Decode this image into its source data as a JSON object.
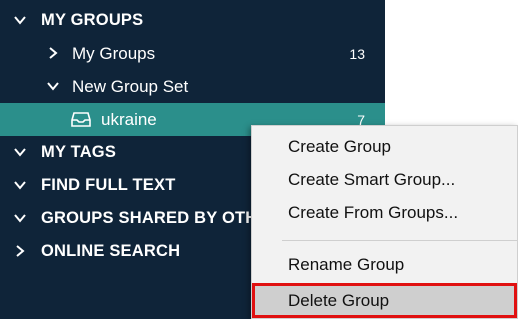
{
  "sidebar": {
    "my_groups_header": "MY GROUPS",
    "my_groups_item": "My Groups",
    "my_groups_count": "13",
    "group_set": "New Group Set",
    "ukraine_label": "ukraine",
    "ukraine_count": "7",
    "my_tags": "MY TAGS",
    "find_full_text": "FIND FULL TEXT",
    "groups_shared": "GROUPS SHARED BY OTHERS",
    "online_search": "ONLINE SEARCH"
  },
  "context_menu": {
    "items": [
      "Create Group",
      "Create Smart Group...",
      "Create From Groups...",
      "Rename Group",
      "Delete Group"
    ]
  },
  "colors": {
    "sidebar_bg": "#0f2439",
    "selected_bg": "#2b8f8b",
    "menu_bg": "#f2f2f2",
    "highlight_border": "#e01010"
  }
}
